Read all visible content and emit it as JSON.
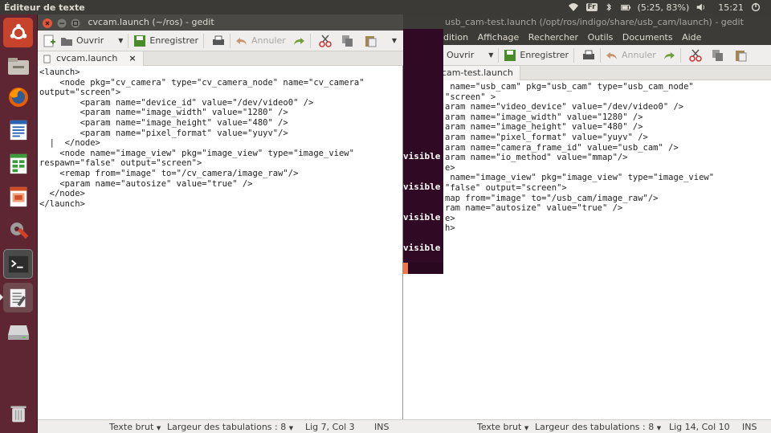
{
  "topbar": {
    "title": "Éditeur de texte",
    "keyboard_layout": "Fr",
    "battery": "(5:25, 83%)",
    "clock": "15:21"
  },
  "launcher": {
    "items": [
      "ubuntu-icon",
      "files-icon",
      "firefox-icon",
      "writer-icon",
      "calc-icon",
      "impress-icon",
      "settings-icon",
      "terminal-icon",
      "gedit-icon",
      "drive-icon",
      "trash-icon"
    ]
  },
  "back_window": {
    "title": "usb_cam-test.launch (/opt/ros/indigo/share/usb_cam/launch) - gedit",
    "menu": [
      "dition",
      "Affichage",
      "Rechercher",
      "Outils",
      "Documents",
      "Aide"
    ],
    "toolbar": {
      "open": "Ouvrir",
      "save": "Enregistrer",
      "undo": "Annuler"
    },
    "tab_label": "cam-test.launch",
    "code": [
      " name=\"usb_cam\" pkg=\"usb_cam\" type=\"usb_cam_node\"",
      "\"screen\" >",
      "aram name=\"video_device\" value=\"/dev/video0\" />",
      "aram name=\"image_width\" value=\"1280\" />",
      "aram name=\"image_height\" value=\"480\" />",
      "aram name=\"pixel_format\" value=\"yuyv\" />",
      "aram name=\"camera_frame_id\" value=\"usb_cam\" />",
      "aram name=\"io_method\" value=\"mmap\"/>",
      "e>",
      " name=\"image_view\" pkg=\"image_view\" type=\"image_view\"",
      "\"false\" output=\"screen\">",
      "map from=\"image\" to=\"/usb_cam/image_raw\"/>",
      "ram name=\"autosize\" value=\"true\" />",
      "e>",
      "h>"
    ],
    "status": {
      "language": "Texte brut",
      "tab_width": "Largeur des tabulations : 8",
      "position": "Lig 14, Col 10",
      "mode": "INS"
    }
  },
  "terminal": {
    "lines": [
      "visible",
      "visible",
      "visible",
      "visible"
    ]
  },
  "front_window": {
    "title": "cvcam.launch (~/ros) - gedit",
    "toolbar": {
      "open": "Ouvrir",
      "save": "Enregistrer",
      "undo": "Annuler"
    },
    "tab_label": "cvcam.launch",
    "code": [
      "<launch>",
      "    <node pkg=\"cv_camera\" type=\"cv_camera_node\" name=\"cv_camera\"",
      "output=\"screen\">",
      "        <param name=\"device_id\" value=\"/dev/video0\" />",
      "        <param name=\"image_width\" value=\"1280\" />",
      "        <param name=\"image_height\" value=\"480\" />",
      "        <param name=\"pixel_format\" value=\"yuyv\"/>",
      "  |  </node>",
      "    <node name=\"image_view\" pkg=\"image_view\" type=\"image_view\"",
      "respawn=\"false\" output=\"screen\">",
      "    <remap from=\"image\" to=\"/cv_camera/image_raw\"/>",
      "    <param name=\"autosize\" value=\"true\" />",
      "  </node>",
      "</launch>"
    ],
    "status": {
      "language": "Texte brut",
      "tab_width": "Largeur des tabulations : 8",
      "position": "Lig 7, Col 3",
      "mode": "INS"
    }
  },
  "colors": {
    "launcher": "#5e2632",
    "terminal": "#300a24",
    "titlebar": "#3c3b37",
    "accent": "#f07746"
  }
}
